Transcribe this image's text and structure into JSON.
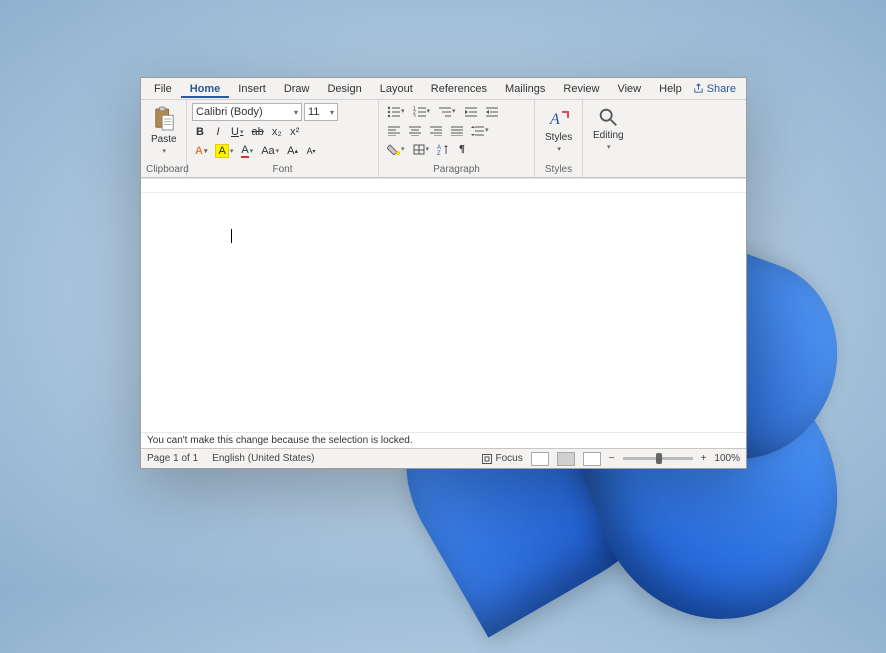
{
  "tabs": {
    "file": "File",
    "home": "Home",
    "insert": "Insert",
    "draw": "Draw",
    "design": "Design",
    "layout": "Layout",
    "references": "References",
    "mailings": "Mailings",
    "review": "Review",
    "view": "View",
    "help": "Help"
  },
  "share_label": "Share",
  "ribbon": {
    "clipboard": {
      "paste": "Paste",
      "group_label": "Clipboard"
    },
    "font": {
      "font_name": "Calibri (Body)",
      "font_size": "11",
      "bold": "B",
      "italic": "I",
      "underline": "U",
      "strike": "ab",
      "subscript": "x₂",
      "superscript": "x²",
      "texteffects": "A",
      "highlight": "A",
      "fontcolor": "A",
      "changecase": "Aa",
      "grow": "A˄",
      "shrink": "A˅",
      "group_label": "Font"
    },
    "paragraph": {
      "group_label": "Paragraph"
    },
    "styles": {
      "label": "Styles",
      "group_label": "Styles"
    },
    "editing": {
      "label": "Editing"
    }
  },
  "lock_message": "You can't make this change because the selection is locked.",
  "statusbar": {
    "page": "Page 1 of 1",
    "language": "English (United States)",
    "focus": "Focus",
    "zoom": "100%"
  }
}
